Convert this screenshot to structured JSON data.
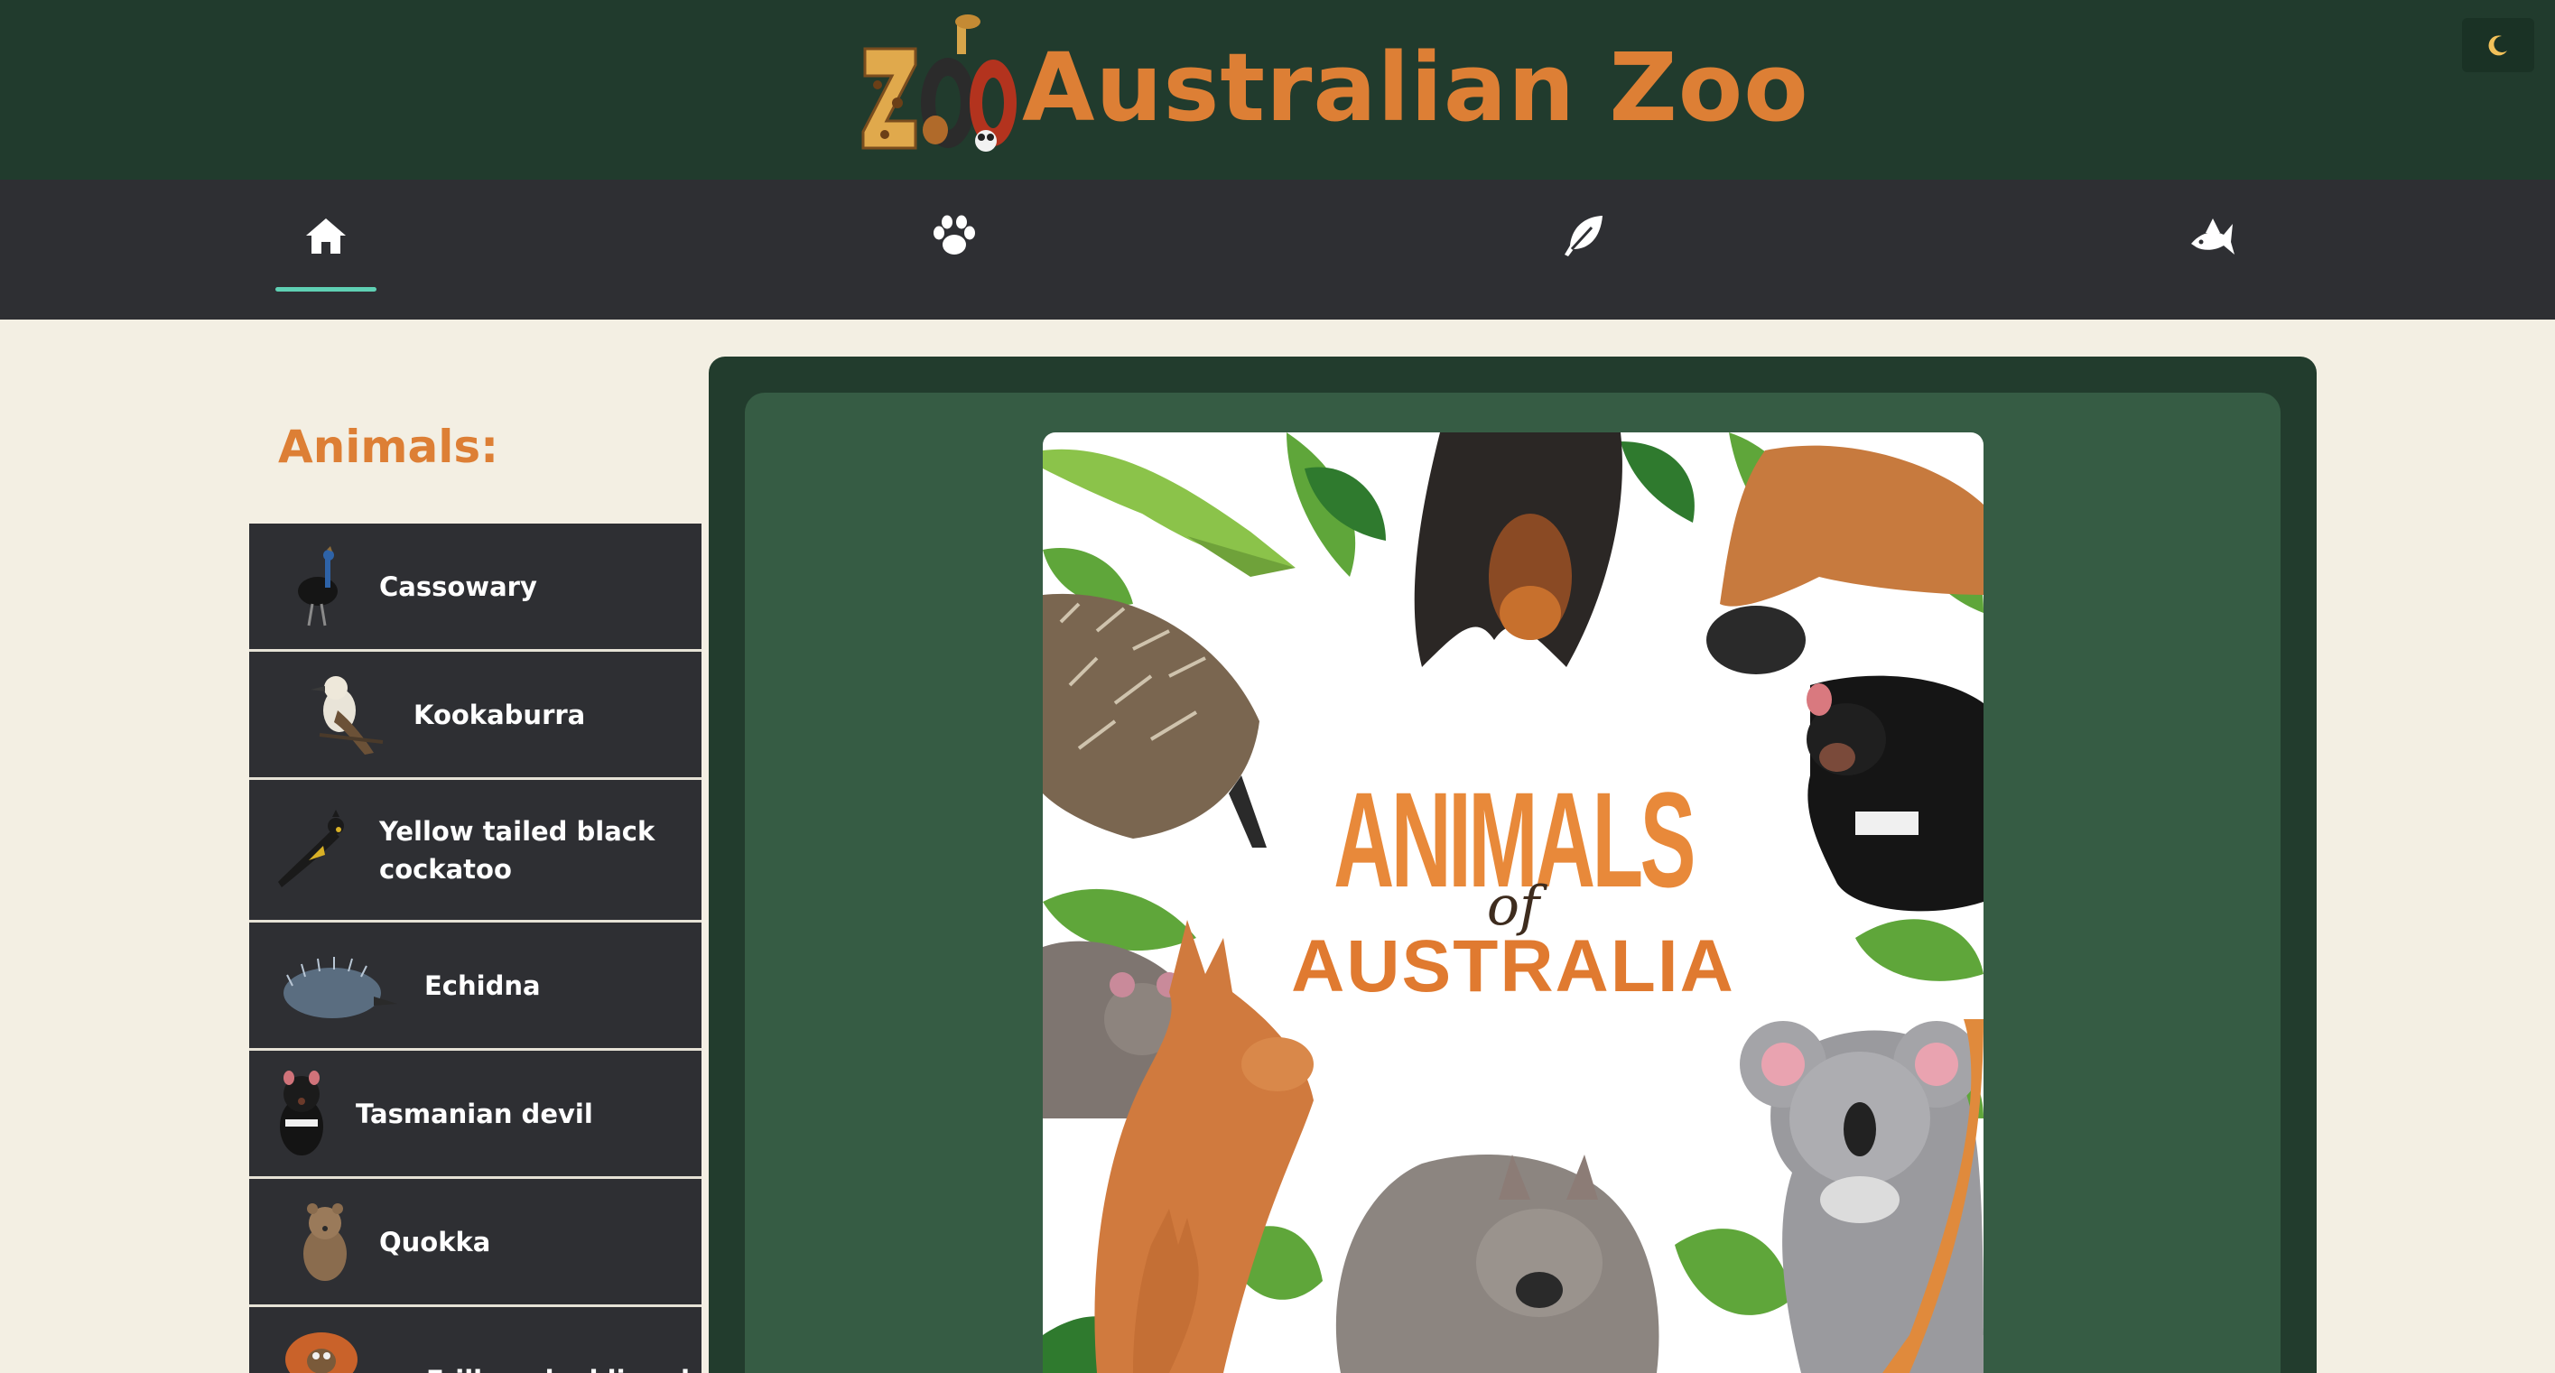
{
  "header": {
    "logo_text": "ZOO",
    "title": "Australian Zoo",
    "theme_toggle_icon": "moon-icon"
  },
  "nav": {
    "items": [
      {
        "icon": "home-icon",
        "active": true
      },
      {
        "icon": "paw-icon",
        "active": false
      },
      {
        "icon": "feather-icon",
        "active": false
      },
      {
        "icon": "fish-icon",
        "active": false
      }
    ],
    "active_color": "#5fd0b4"
  },
  "sidebar": {
    "title": "Animals:",
    "items": [
      {
        "label": "Cassowary",
        "thumb": "cassowary-icon"
      },
      {
        "label": "Kookaburra",
        "thumb": "kookaburra-icon"
      },
      {
        "label": "Yellow tailed black cockatoo",
        "thumb": "cockatoo-icon"
      },
      {
        "label": "Echidna",
        "thumb": "echidna-icon"
      },
      {
        "label": "Tasmanian devil",
        "thumb": "tasmanian-devil-icon"
      },
      {
        "label": "Quokka",
        "thumb": "quokka-icon"
      },
      {
        "label": "Frill-necked lizard",
        "thumb": "lizard-icon"
      }
    ]
  },
  "poster": {
    "line1": "ANIMALS",
    "line2": "of",
    "line3": "AUSTRALIA"
  },
  "colors": {
    "accent": "#dd7f35",
    "header_bg": "#213b2d",
    "nav_bg": "#2e2f33",
    "page_bg": "#f3efe3",
    "panel_bg": "#365c44"
  }
}
